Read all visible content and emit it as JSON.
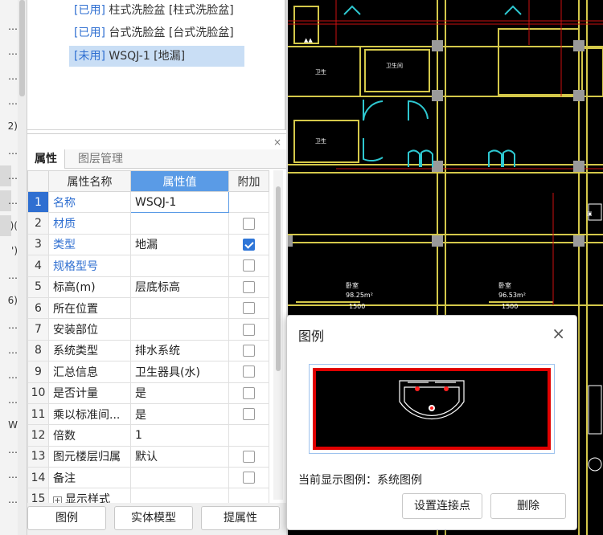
{
  "left_strip": {
    "fragments": [
      "…",
      "…",
      "…",
      "…",
      "2)",
      "…",
      "…",
      "…",
      ")(",
      "')",
      "…",
      "6)",
      "…",
      "…",
      "…",
      "…",
      "W",
      "…",
      "…",
      "…"
    ]
  },
  "tree": {
    "items": [
      {
        "status": "[已用]",
        "label": "柱式洗脸盆 [柱式洗脸盆]",
        "selected": false
      },
      {
        "status": "[已用]",
        "label": "台式洗脸盆 [台式洗脸盆]",
        "selected": false
      },
      {
        "status": "[未用]",
        "label": "WSQJ-1 [地漏]",
        "selected": true
      }
    ]
  },
  "properties_panel": {
    "close_label": "×",
    "tabs": [
      {
        "label": "属性",
        "active": true
      },
      {
        "label": "图层管理",
        "active": false
      }
    ],
    "columns": {
      "name": "属性名称",
      "value": "属性值",
      "extra": "附加"
    },
    "rows": [
      {
        "num": "1",
        "name": "名称",
        "value": "WSQJ-1",
        "blue": true,
        "checkbox": "none"
      },
      {
        "num": "2",
        "name": "材质",
        "value": "",
        "blue": true,
        "checkbox": "off"
      },
      {
        "num": "3",
        "name": "类型",
        "value": "地漏",
        "blue": true,
        "checkbox": "on"
      },
      {
        "num": "4",
        "name": "规格型号",
        "value": "",
        "blue": true,
        "checkbox": "off"
      },
      {
        "num": "5",
        "name": "标高(m)",
        "value": "层底标高",
        "blue": false,
        "checkbox": "off"
      },
      {
        "num": "6",
        "name": "所在位置",
        "value": "",
        "blue": false,
        "checkbox": "off"
      },
      {
        "num": "7",
        "name": "安装部位",
        "value": "",
        "blue": false,
        "checkbox": "off"
      },
      {
        "num": "8",
        "name": "系统类型",
        "value": "排水系统",
        "blue": false,
        "checkbox": "off"
      },
      {
        "num": "9",
        "name": "汇总信息",
        "value": "卫生器具(水)",
        "blue": false,
        "checkbox": "off"
      },
      {
        "num": "10",
        "name": "是否计量",
        "value": "是",
        "blue": false,
        "checkbox": "off"
      },
      {
        "num": "11",
        "name": "乘以标准间...",
        "value": "是",
        "blue": false,
        "checkbox": "off"
      },
      {
        "num": "12",
        "name": "倍数",
        "value": "1",
        "blue": false,
        "checkbox": "none"
      },
      {
        "num": "13",
        "name": "图元楼层归属",
        "value": "默认",
        "blue": false,
        "checkbox": "off"
      },
      {
        "num": "14",
        "name": "备注",
        "value": "",
        "blue": false,
        "checkbox": "off"
      },
      {
        "num": "15",
        "name": "显示样式",
        "value": "",
        "blue": false,
        "checkbox": "none",
        "expandable": true
      }
    ]
  },
  "bottom_buttons": {
    "legend": "图例",
    "solid_model": "实体模型",
    "extract": "提属性"
  },
  "cad": {
    "room_labels": [
      {
        "name": "卧室",
        "area": "98.25m²",
        "code": "1500"
      },
      {
        "name": "卧室",
        "area": "96.53m²",
        "code": "1500"
      }
    ]
  },
  "legend_dialog": {
    "title": "图例",
    "close": "×",
    "current_label": "当前显示图例：系统图例",
    "btn_connect": "设置连接点",
    "btn_delete": "删除"
  },
  "colors": {
    "accent_blue": "#2f6fd1",
    "header_blue": "#5a9be6",
    "selection": "#c9def5",
    "cad_yellow": "#d4c84a",
    "cad_red": "#e00000"
  }
}
